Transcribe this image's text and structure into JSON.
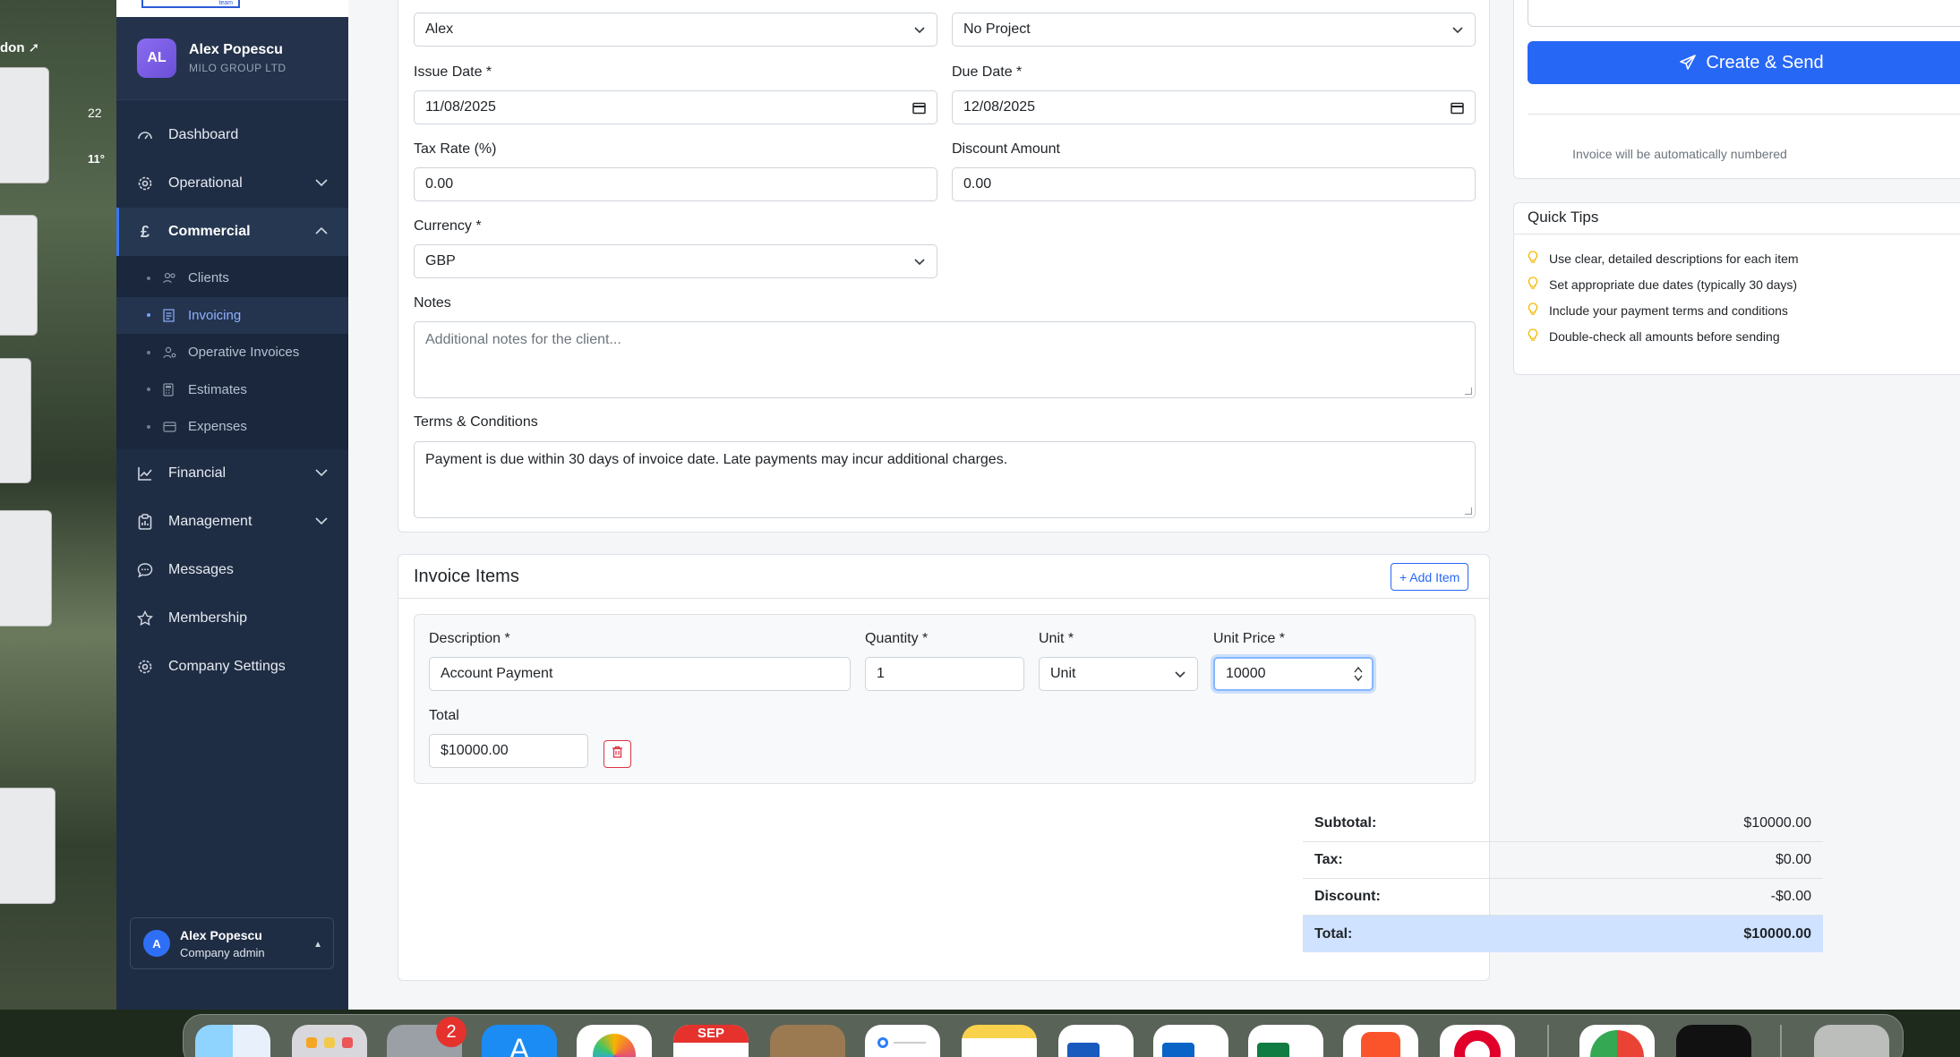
{
  "desktop": {
    "weather_city": "don",
    "weather_hi": "22",
    "weather_lo": "11°"
  },
  "sidebar": {
    "user": {
      "initials": "AL",
      "name": "Alex Popescu",
      "company": "MILO GROUP LTD"
    },
    "items": [
      {
        "label": "Dashboard",
        "icon": "gauge-icon"
      },
      {
        "label": "Operational",
        "icon": "gear-icon"
      },
      {
        "label": "Commercial",
        "icon": "pound-icon"
      },
      {
        "label": "Financial",
        "icon": "chart-line-icon"
      },
      {
        "label": "Management",
        "icon": "clipboard-icon"
      },
      {
        "label": "Messages",
        "icon": "chat-icon"
      },
      {
        "label": "Membership",
        "icon": "star-icon"
      },
      {
        "label": "Company Settings",
        "icon": "cog-icon"
      }
    ],
    "commercial_sub": [
      {
        "label": "Clients"
      },
      {
        "label": "Invoicing"
      },
      {
        "label": "Operative Invoices"
      },
      {
        "label": "Estimates"
      },
      {
        "label": "Expenses"
      }
    ],
    "footer": {
      "initial": "A",
      "name": "Alex Popescu",
      "role": "Company admin"
    }
  },
  "form": {
    "client_value": "Alex",
    "project_value": "No Project",
    "issue_date_label": "Issue Date *",
    "issue_date_value": "11/08/2025",
    "due_date_label": "Due Date *",
    "due_date_value": "12/08/2025",
    "tax_rate_label": "Tax Rate (%)",
    "tax_rate_value": "0.00",
    "discount_label": "Discount Amount",
    "discount_value": "0.00",
    "currency_label": "Currency *",
    "currency_value": "GBP",
    "notes_label": "Notes",
    "notes_placeholder": "Additional notes for the client...",
    "terms_label": "Terms & Conditions",
    "terms_value": "Payment is due within 30 days of invoice date. Late payments may incur additional charges."
  },
  "items": {
    "title": "Invoice Items",
    "add_label": "+ Add Item",
    "description_label": "Description *",
    "quantity_label": "Quantity *",
    "unit_label": "Unit *",
    "unit_price_label": "Unit Price *",
    "total_label": "Total",
    "row": {
      "description": "Account Payment",
      "quantity": "1",
      "unit": "Unit",
      "unit_price": "10000",
      "total": "$10000.00"
    }
  },
  "summary": {
    "subtotal_label": "Subtotal:",
    "subtotal": "$10000.00",
    "tax_label": "Tax:",
    "tax": "$0.00",
    "discount_label": "Discount:",
    "discount": "-$0.00",
    "total_label": "Total:",
    "total": "$10000.00"
  },
  "actions": {
    "send_label": "Create & Send",
    "auto_number_note": "Invoice will be automatically numbered"
  },
  "tips": {
    "title": "Quick Tips",
    "list": [
      "Use clear, detailed descriptions for each item",
      "Set appropriate due dates (typically 30 days)",
      "Include your payment terms and conditions",
      "Double-check all amounts before sending"
    ]
  },
  "dock": {
    "notification_count": "2",
    "calendar_month": "SEP"
  },
  "colors": {
    "sidebar": "#1f2d44",
    "primary": "#2767f6",
    "total_bg": "#cfe2ff",
    "danger": "#dc3545"
  }
}
